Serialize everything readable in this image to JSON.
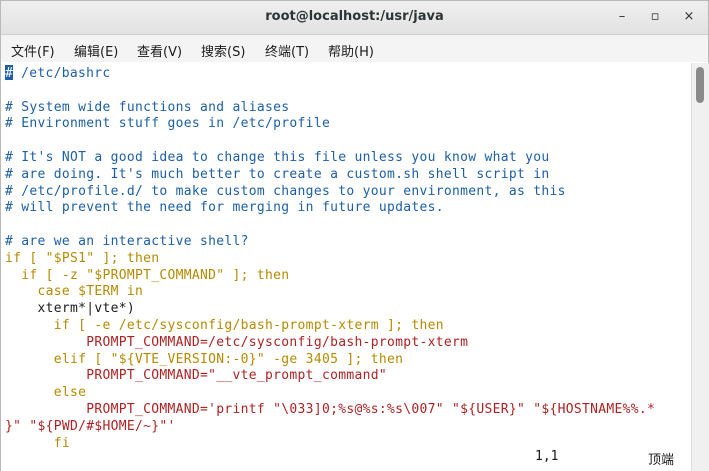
{
  "window": {
    "title": "root@localhost:/usr/java",
    "minimize": "–",
    "maximize": "▫",
    "close": "×"
  },
  "menu": [
    {
      "label": "文件(F)"
    },
    {
      "label": "编辑(E)"
    },
    {
      "label": "查看(V)"
    },
    {
      "label": "搜索(S)"
    },
    {
      "label": "终端(T)"
    },
    {
      "label": "帮助(H)"
    }
  ],
  "terminal": {
    "lines": [
      {
        "text": "# /etc/bashrc",
        "type": "comment",
        "cursor": true
      },
      {
        "text": "",
        "type": "plain"
      },
      {
        "text": "# System wide functions and aliases",
        "type": "comment"
      },
      {
        "text": "# Environment stuff goes in /etc/profile",
        "type": "comment"
      },
      {
        "text": "",
        "type": "plain"
      },
      {
        "text": "# It's NOT a good idea to change this file unless you know what you",
        "type": "comment"
      },
      {
        "text": "# are doing. It's much better to create a custom.sh shell script in",
        "type": "comment"
      },
      {
        "text": "# /etc/profile.d/ to make custom changes to your environment, as this",
        "type": "comment"
      },
      {
        "text": "# will prevent the need for merging in future updates.",
        "type": "comment"
      },
      {
        "text": "",
        "type": "plain"
      },
      {
        "text": "# are we an interactive shell?",
        "type": "comment"
      },
      {
        "text": "if [ \"$PS1\" ]; then",
        "type": "key"
      },
      {
        "text": "  if [ -z \"$PROMPT_COMMAND\" ]; then",
        "type": "key"
      },
      {
        "text": "    case $TERM in",
        "type": "key"
      },
      {
        "text": "    xterm*|vte*)",
        "type": "plain"
      },
      {
        "text": "      if [ -e /etc/sysconfig/bash-prompt-xterm ]; then",
        "type": "key"
      },
      {
        "text": "          PROMPT_COMMAND=/etc/sysconfig/bash-prompt-xterm",
        "type": "str"
      },
      {
        "text": "      elif [ \"${VTE_VERSION:-0}\" -ge 3405 ]; then",
        "type": "key"
      },
      {
        "text": "          PROMPT_COMMAND=\"__vte_prompt_command\"",
        "type": "str"
      },
      {
        "text": "      else",
        "type": "key"
      },
      {
        "text": "          PROMPT_COMMAND='printf \"\\033]0;%s@%s:%s\\007\" \"${USER}\" \"${HOSTNAME%%.*",
        "type": "str"
      },
      {
        "text": "}\" \"${PWD/#$HOME/~}\"'",
        "type": "str"
      },
      {
        "text": "      fi",
        "type": "key"
      }
    ]
  },
  "status": {
    "position": "1,1",
    "scroll": "顶端"
  },
  "colors": {
    "comment": "#1d5fa8",
    "keyword": "#b58a00",
    "string": "#b02222"
  }
}
